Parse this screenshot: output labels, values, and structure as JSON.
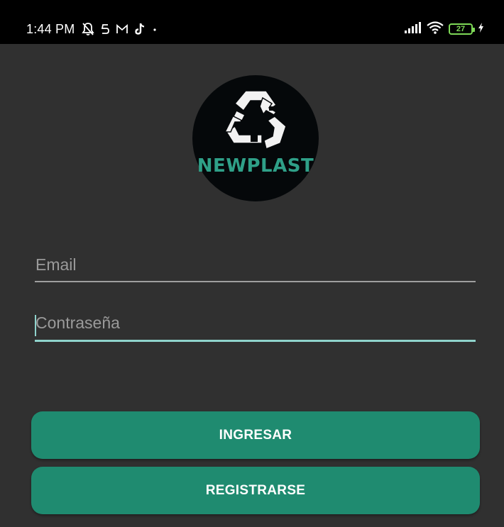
{
  "status_bar": {
    "time": "1:44 PM",
    "icons_left": [
      "bell-muted-icon",
      "s-app-icon",
      "gmail-icon",
      "tiktok-icon",
      "dot-icon"
    ],
    "icons_right": [
      "signal-icon",
      "wifi-icon",
      "battery-icon",
      "charging-icon"
    ],
    "battery_level": "27",
    "battery_color": "#7ed957"
  },
  "logo": {
    "brand_text": "NEWPLAST",
    "brand_color": "#2fa088"
  },
  "form": {
    "email_placeholder": "Email",
    "email_value": "",
    "password_placeholder": "Contraseña",
    "password_value": ""
  },
  "buttons": {
    "login_label": "INGRESAR",
    "register_label": "REGISTRARSE",
    "accent_color": "#1f8b70"
  }
}
